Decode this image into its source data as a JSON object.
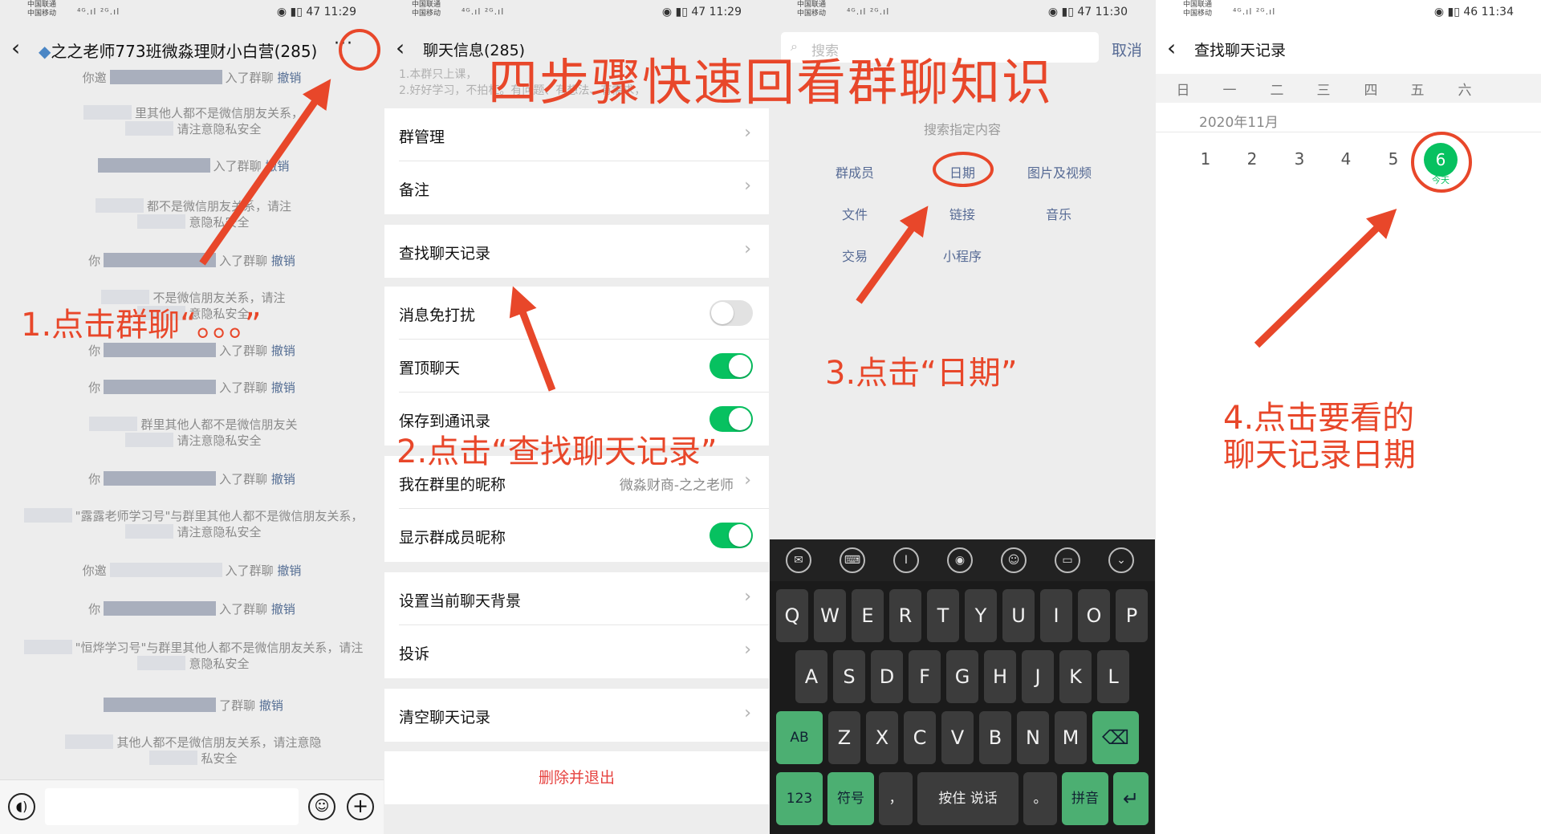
{
  "overlay": {
    "main_title": "四步骤快速回看群聊知识",
    "step1": "1.点击群聊“。。。”",
    "step2": "2.点击“查找聊天记录”",
    "step3": "3.点击“日期”",
    "step4_line1": "4.点击要看的",
    "step4_line2": "聊天记录日期",
    "accent_color": "#e8472a"
  },
  "status_bar": {
    "carrier_top": "中国联通",
    "carrier_bottom": "中国移动",
    "signal_glyph": "⁴ᴳ.ıl ²ᴳ.ıl",
    "times": [
      "11:29",
      "11:29",
      "11:30",
      "11:34"
    ],
    "battery": [
      "47",
      "47",
      "47",
      "46"
    ]
  },
  "panel1": {
    "title": "之之老师773班微淼理财小白营(285)",
    "more_icon": "more-dots-icon",
    "more_glyph": "···",
    "messages": [
      {
        "a": "你邀",
        "b": "入了群聊",
        "revoke": "撤销"
      },
      {
        "a": "",
        "b": "里其他人都不是微信朋友关系，"
      },
      {
        "a": "",
        "b": "请注意隐私安全"
      },
      {
        "a": "",
        "b": "入了群聊",
        "revoke": "撤销"
      },
      {
        "a": "",
        "b": "都不是微信朋友关系，请注"
      },
      {
        "a": "",
        "b": "意隐私安全"
      },
      {
        "a": "你",
        "b": "入了群聊",
        "revoke": "撤销"
      },
      {
        "a": "",
        "b": "不是微信朋友关系，请注"
      },
      {
        "a": "",
        "b": "意隐私安全"
      },
      {
        "a": "你",
        "b": "入了群聊",
        "revoke": "撤销"
      },
      {
        "a": "你",
        "b": "入了群聊",
        "revoke": "撤销"
      },
      {
        "a": "",
        "b": "群里其他人都不是微信朋友关"
      },
      {
        "a": "",
        "b": "请注意隐私安全"
      },
      {
        "a": "你",
        "b": "入了群聊",
        "revoke": "撤销"
      },
      {
        "a": "",
        "b": "\"露露老师学习号\"与群里其他人都不是微信朋友关系，"
      },
      {
        "a": "",
        "b": "请注意隐私安全"
      },
      {
        "a": "你邀",
        "b": "入了群聊",
        "revoke": "撤销"
      },
      {
        "a": "你",
        "b": "入了群聊",
        "revoke": "撤销"
      },
      {
        "a": "",
        "b": "\"恒烨学习号\"与群里其他人都不是微信朋友关系，请注"
      },
      {
        "a": "",
        "b": "意隐私安全"
      },
      {
        "a": "",
        "b": "了群聊",
        "revoke": "撤销"
      },
      {
        "a": "",
        "b": "其他人都不是微信朋友关系，请注意隐"
      },
      {
        "a": "",
        "b": "私安全"
      }
    ]
  },
  "panel2": {
    "title": "聊天信息(285)",
    "notice_line1": "1.本群只上课，",
    "notice_line2": "2.好好学习，不拍杠。有问题、有想法、有需求，",
    "rows": {
      "manage": "群管理",
      "remark": "备注",
      "search_history": "查找聊天记录",
      "mute": "消息免打扰",
      "pin": "置顶聊天",
      "save_contacts": "保存到通讯录",
      "nickname": "我在群里的昵称",
      "nickname_value": "微淼财商-之之老师",
      "show_names": "显示群成员昵称",
      "background": "设置当前聊天背景",
      "report": "投诉",
      "clear": "清空聊天记录",
      "delete_exit": "删除并退出"
    },
    "toggles": {
      "mute": false,
      "pin": true,
      "save_contacts": true,
      "show_names": true
    }
  },
  "panel3": {
    "search_placeholder": "搜索",
    "cancel": "取消",
    "hint": "搜索指定内容",
    "categories": [
      "群成员",
      "日期",
      "图片及视频",
      "文件",
      "链接",
      "音乐",
      "交易",
      "小程序"
    ],
    "keyboard": {
      "row1": [
        "Q",
        "W",
        "E",
        "R",
        "T",
        "Y",
        "U",
        "I",
        "O",
        "P"
      ],
      "row2": [
        "A",
        "S",
        "D",
        "F",
        "G",
        "H",
        "J",
        "K",
        "L"
      ],
      "row3": [
        "AB",
        "Z",
        "X",
        "C",
        "V",
        "B",
        "N",
        "M",
        "⌫"
      ],
      "row4": [
        "123",
        "符号",
        "，",
        "按住 说话",
        "。",
        "拼音",
        "↵"
      ]
    }
  },
  "panel4": {
    "title": "查找聊天记录",
    "weekdays": [
      "日",
      "一",
      "二",
      "三",
      "四",
      "五",
      "六"
    ],
    "month": "2020年11月",
    "days": [
      "1",
      "2",
      "3",
      "4",
      "5"
    ],
    "today_day": "6",
    "today_label": "今天"
  }
}
